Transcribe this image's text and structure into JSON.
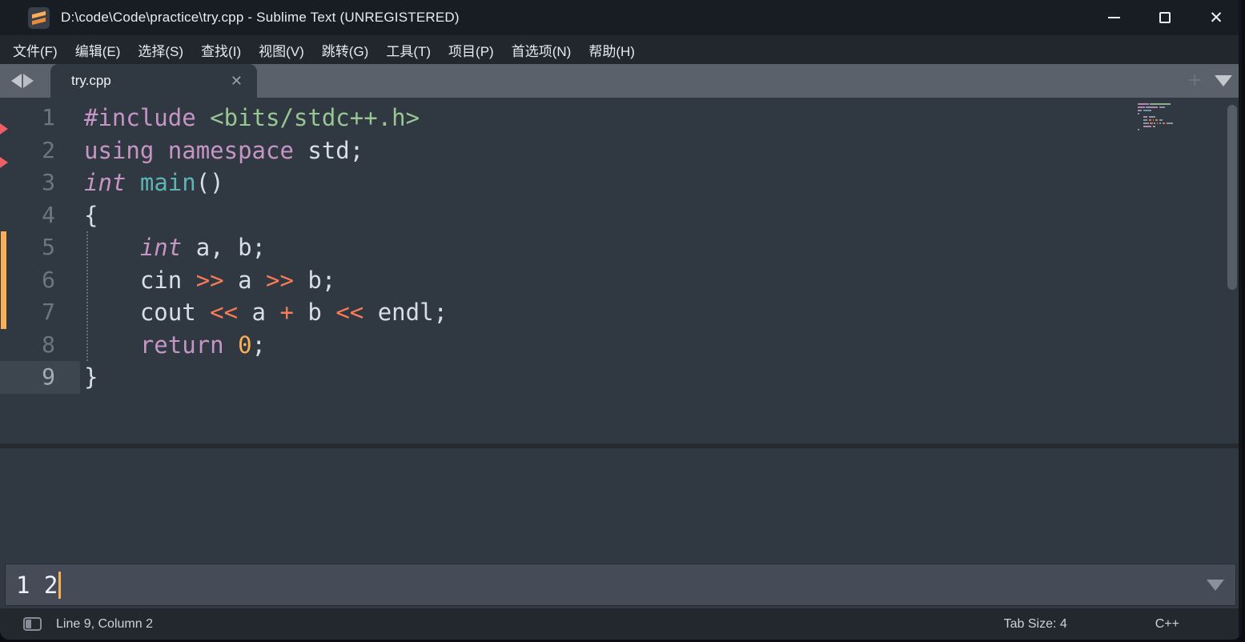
{
  "window": {
    "title": "D:\\code\\Code\\practice\\try.cpp - Sublime Text (UNREGISTERED)",
    "controls": {
      "minimize": "—",
      "maximize": "□",
      "close": "✕"
    }
  },
  "menu": {
    "items": [
      "文件(F)",
      "编辑(E)",
      "选择(S)",
      "查找(I)",
      "视图(V)",
      "跳转(G)",
      "工具(T)",
      "项目(P)",
      "首选项(N)",
      "帮助(H)"
    ]
  },
  "tabbar": {
    "active_tab": {
      "label": "try.cpp",
      "close_label": "✕"
    }
  },
  "editor": {
    "current_line": 9,
    "code_lines": [
      {
        "n": 1,
        "tokens": [
          {
            "t": "#include",
            "c": "kw"
          },
          {
            "t": " ",
            "c": "pl"
          },
          {
            "t": "<bits/stdc++.h>",
            "c": "str"
          }
        ]
      },
      {
        "n": 2,
        "tokens": [
          {
            "t": "using",
            "c": "kw"
          },
          {
            "t": " ",
            "c": "pl"
          },
          {
            "t": "namespace",
            "c": "kw"
          },
          {
            "t": " std;",
            "c": "pl"
          }
        ]
      },
      {
        "n": 3,
        "tokens": [
          {
            "t": "int",
            "c": "kwi"
          },
          {
            "t": " ",
            "c": "pl"
          },
          {
            "t": "main",
            "c": "fn"
          },
          {
            "t": "()",
            "c": "pl"
          }
        ]
      },
      {
        "n": 4,
        "tokens": [
          {
            "t": "{",
            "c": "pl"
          }
        ]
      },
      {
        "n": 5,
        "tokens": [
          {
            "t": "    ",
            "c": "pl"
          },
          {
            "t": "int",
            "c": "kwi"
          },
          {
            "t": " a, b;",
            "c": "pl"
          }
        ]
      },
      {
        "n": 6,
        "tokens": [
          {
            "t": "    cin ",
            "c": "pl"
          },
          {
            "t": ">>",
            "c": "op"
          },
          {
            "t": " a ",
            "c": "pl"
          },
          {
            "t": ">>",
            "c": "op"
          },
          {
            "t": " b;",
            "c": "pl"
          }
        ]
      },
      {
        "n": 7,
        "tokens": [
          {
            "t": "    cout ",
            "c": "pl"
          },
          {
            "t": "<<",
            "c": "op"
          },
          {
            "t": " a ",
            "c": "pl"
          },
          {
            "t": "+",
            "c": "op"
          },
          {
            "t": " b ",
            "c": "pl"
          },
          {
            "t": "<<",
            "c": "op"
          },
          {
            "t": " endl;",
            "c": "pl"
          }
        ]
      },
      {
        "n": 8,
        "tokens": [
          {
            "t": "    ",
            "c": "pl"
          },
          {
            "t": "return",
            "c": "kw"
          },
          {
            "t": " ",
            "c": "pl"
          },
          {
            "t": "0",
            "c": "num"
          },
          {
            "t": ";",
            "c": "pl"
          }
        ]
      },
      {
        "n": 9,
        "tokens": [
          {
            "t": "}",
            "c": "pl"
          }
        ]
      }
    ],
    "diff_markers": {
      "modified_lines": "5-7",
      "deleted_marker_positions": "after line 1, after line 2"
    }
  },
  "panel": {
    "input_value": "1 2"
  },
  "statusbar": {
    "caret_position": "Line 9, Column 2",
    "tab_size": "Tab Size: 4",
    "syntax": "C++"
  },
  "colors": {
    "editor_bg": "#303841",
    "titlebar_bg": "#181c23",
    "menubar_bg": "#22262d",
    "tabbar_bg": "#5a616b",
    "statusbar_bg": "#23272e",
    "panel_input_bg": "#454c57",
    "foreground": "#d8dee9",
    "gutter_fg": "#6b7680",
    "accent_orange": "#f9ae58",
    "keyword_pink": "#c695c6",
    "string_green": "#99c794",
    "function_teal": "#5fb4b4",
    "operator_orange": "#f97b58",
    "number_orange": "#f9ae58",
    "diff_red": "#ec5f66"
  },
  "icons": {
    "app": "sublime-logo-icon",
    "tab_nav": [
      "history-back-icon",
      "history-forward-icon"
    ],
    "tab_actions": [
      "new-tab-icon",
      "tab-overflow-icon"
    ],
    "panel": "dropdown-icon",
    "statusbar": "sidebar-toggle-icon"
  }
}
